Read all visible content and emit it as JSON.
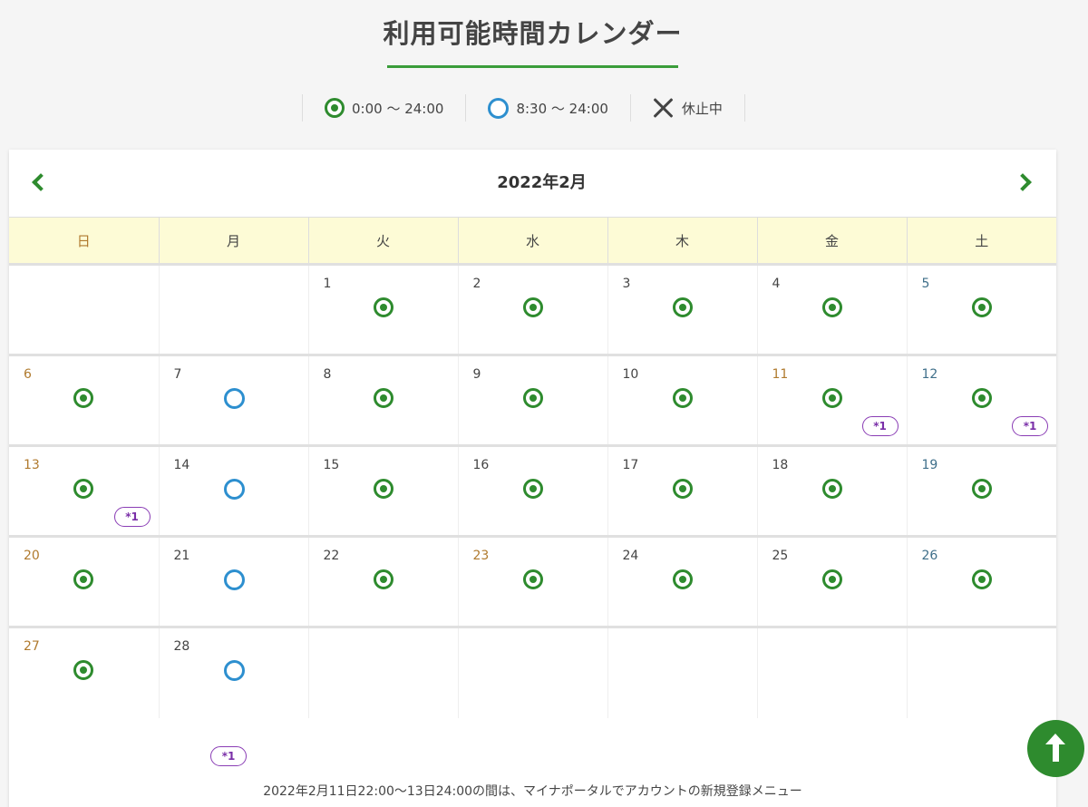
{
  "page": {
    "title": "利用可能時間カレンダー"
  },
  "legend": [
    {
      "icon": "double-circle",
      "label": "0:00 ～ 24:00"
    },
    {
      "icon": "circle",
      "label": "8:30 ～ 24:00"
    },
    {
      "icon": "cross",
      "label": "休止中"
    }
  ],
  "calendar": {
    "month": "2022年2月",
    "weekdays": [
      "日",
      "月",
      "火",
      "水",
      "木",
      "金",
      "土"
    ],
    "weeks": [
      [
        null,
        null,
        {
          "day": "1",
          "mark": "double-circle"
        },
        {
          "day": "2",
          "mark": "double-circle"
        },
        {
          "day": "3",
          "mark": "double-circle"
        },
        {
          "day": "4",
          "mark": "double-circle"
        },
        {
          "day": "5",
          "mark": "double-circle",
          "type": "sat"
        }
      ],
      [
        {
          "day": "6",
          "mark": "double-circle",
          "type": "holiday"
        },
        {
          "day": "7",
          "mark": "circle"
        },
        {
          "day": "8",
          "mark": "double-circle"
        },
        {
          "day": "9",
          "mark": "double-circle"
        },
        {
          "day": "10",
          "mark": "double-circle"
        },
        {
          "day": "11",
          "mark": "double-circle",
          "type": "holiday",
          "note": "*1"
        },
        {
          "day": "12",
          "mark": "double-circle",
          "type": "sat",
          "note": "*1"
        }
      ],
      [
        {
          "day": "13",
          "mark": "double-circle",
          "type": "holiday",
          "note": "*1"
        },
        {
          "day": "14",
          "mark": "circle"
        },
        {
          "day": "15",
          "mark": "double-circle"
        },
        {
          "day": "16",
          "mark": "double-circle"
        },
        {
          "day": "17",
          "mark": "double-circle"
        },
        {
          "day": "18",
          "mark": "double-circle"
        },
        {
          "day": "19",
          "mark": "double-circle",
          "type": "sat"
        }
      ],
      [
        {
          "day": "20",
          "mark": "double-circle",
          "type": "holiday"
        },
        {
          "day": "21",
          "mark": "circle"
        },
        {
          "day": "22",
          "mark": "double-circle"
        },
        {
          "day": "23",
          "mark": "double-circle",
          "type": "holiday"
        },
        {
          "day": "24",
          "mark": "double-circle"
        },
        {
          "day": "25",
          "mark": "double-circle"
        },
        {
          "day": "26",
          "mark": "double-circle",
          "type": "sat"
        }
      ],
      [
        {
          "day": "27",
          "mark": "double-circle",
          "type": "holiday"
        },
        {
          "day": "28",
          "mark": "circle"
        },
        null,
        null,
        null,
        null,
        null
      ]
    ]
  },
  "footnote": {
    "badge": "*1",
    "text": "2022年2月11日22:00～13日24:00の間は、マイナポータルでアカウントの新規登録メニュー"
  },
  "colors": {
    "accent": "#2e8b2e",
    "circle": "#2d8fcf",
    "note": "#7a2fa8",
    "weekday_header_bg": "#fdfbd6"
  }
}
